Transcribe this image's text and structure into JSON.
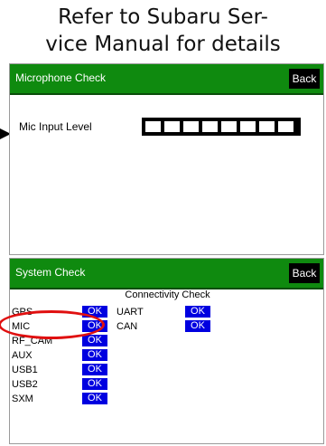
{
  "heading": {
    "line1": "Refer to Subaru Ser-",
    "line2": "vice Manual for details"
  },
  "microphone_check": {
    "title": "Microphone Check",
    "back_label": "Back",
    "mic_input_label": "Mic Input Level",
    "level_segments": 8,
    "level_filled": 0
  },
  "system_check": {
    "title": "System Check",
    "back_label": "Back",
    "section_title": "Connectivity Check",
    "left_items": [
      {
        "label": "GPS",
        "status": "OK"
      },
      {
        "label": "MIC",
        "status": "OK"
      },
      {
        "label": "RF_CAM",
        "status": "OK"
      },
      {
        "label": "AUX",
        "status": "OK"
      },
      {
        "label": "USB1",
        "status": "OK"
      },
      {
        "label": "USB2",
        "status": "OK"
      },
      {
        "label": "SXM",
        "status": "OK"
      }
    ],
    "right_items": [
      {
        "label": "UART",
        "status": "OK"
      },
      {
        "label": "CAN",
        "status": "OK"
      }
    ]
  },
  "colors": {
    "titlebar": "#0f8a0f",
    "status_ok": "#0000e0",
    "highlight": "#e01010"
  }
}
